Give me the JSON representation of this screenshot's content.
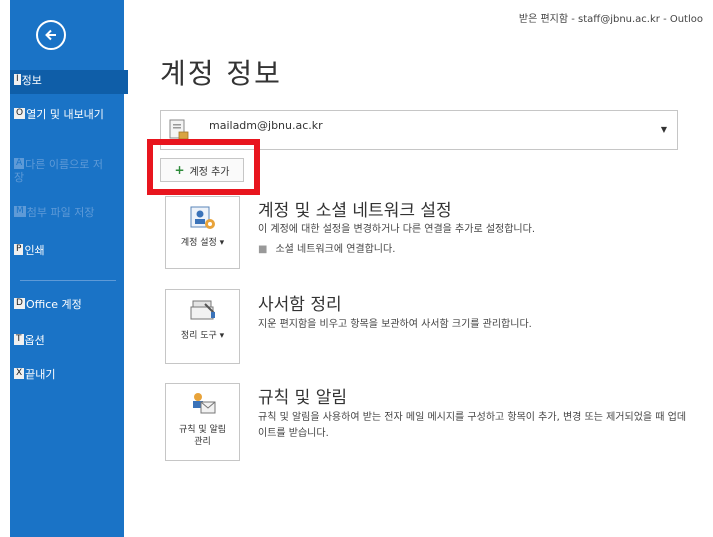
{
  "window": {
    "title": "받은 편지함 - staff@jbnu.ac.kr - Outloo"
  },
  "sidebar": {
    "items": [
      {
        "key": "I",
        "label": "정보"
      },
      {
        "key": "O",
        "label": "열기 및 내보내기"
      },
      {
        "key": "A",
        "label": "다른 이름으로 저장"
      },
      {
        "key": "M",
        "label": "첨부 파일 저장"
      },
      {
        "key": "P",
        "label": "인쇄"
      },
      {
        "key": "D",
        "label": "Office 계정"
      },
      {
        "key": "T",
        "label": "옵션"
      },
      {
        "key": "X",
        "label": "끝내기"
      }
    ]
  },
  "main": {
    "page_title": "계정 정보",
    "account": {
      "email": "mailadm@jbnu.ac.kr"
    },
    "add_account_label": "계정 추가",
    "sections": [
      {
        "tile_label": "계정 설정 ▾",
        "title": "계정 및 소셜 네트워크 설정",
        "desc": "이 계정에 대한 설정을 변경하거나 다른 연결을 추가로 설정합니다.",
        "bullet": "소셜 네트워크에 연결합니다."
      },
      {
        "tile_label": "정리 도구 ▾",
        "title": "사서함 정리",
        "desc": "지운 편지함을 비우고 항목을 보관하여 사서함 크기를 관리합니다."
      },
      {
        "tile_label": "규칙 및 알림 관리",
        "title": "규칙 및 알림",
        "desc": "규칙 및 알림을 사용하여 받는 전자 메일 메시지를 구성하고 항목이 추가, 변경 또는 제거되었을 때 업데이트를 받습니다."
      }
    ]
  },
  "colors": {
    "sidebar": "#1a73c6",
    "highlight": "#e8151e",
    "accent": "#2e8b3a"
  },
  "icons": [
    "back-arrow-icon",
    "account-icon",
    "plus-icon",
    "account-settings-icon",
    "cleanup-tools-icon",
    "rules-alerts-icon"
  ]
}
